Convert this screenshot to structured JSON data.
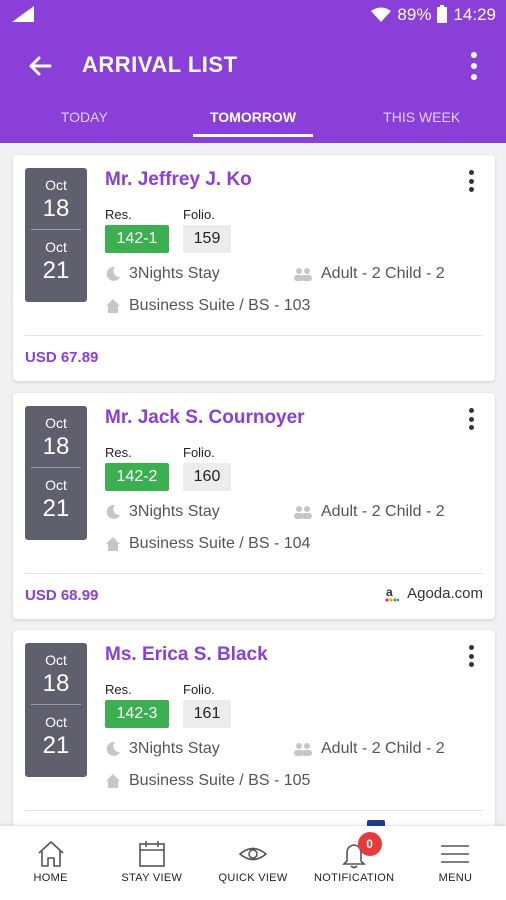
{
  "status_bar": {
    "battery": "89%",
    "time": "14:29"
  },
  "header": {
    "title": "ARRIVAL LIST"
  },
  "tabs": [
    {
      "label": "TODAY",
      "active": false
    },
    {
      "label": "TOMORROW",
      "active": true
    },
    {
      "label": "THIS WEEK",
      "active": false
    }
  ],
  "labels": {
    "res": "Res.",
    "folio": "Folio."
  },
  "reservations": [
    {
      "checkin_month": "Oct",
      "checkin_day": "18",
      "checkout_month": "Oct",
      "checkout_day": "21",
      "guest": "Mr. Jeffrey J. Ko",
      "res_no": "142-1",
      "folio_no": "159",
      "stay": "3Nights Stay",
      "occupancy": "Adult - 2 Child - 2",
      "room": "Business Suite / BS - 103",
      "price": "USD 67.89",
      "source": ""
    },
    {
      "checkin_month": "Oct",
      "checkin_day": "18",
      "checkout_month": "Oct",
      "checkout_day": "21",
      "guest": "Mr. Jack S. Cournoyer",
      "res_no": "142-2",
      "folio_no": "160",
      "stay": "3Nights Stay",
      "occupancy": "Adult - 2 Child - 2",
      "room": "Business Suite / BS - 104",
      "price": "USD 68.99",
      "source": "Agoda.com"
    },
    {
      "checkin_month": "Oct",
      "checkin_day": "18",
      "checkout_month": "Oct",
      "checkout_day": "21",
      "guest": "Ms. Erica S. Black",
      "res_no": "142-3",
      "folio_no": "161",
      "stay": "3Nights Stay",
      "occupancy": "Adult - 2 Child - 2",
      "room": "Business Suite / BS - 105",
      "price": "",
      "source": ""
    }
  ],
  "bottom_nav": [
    {
      "label": "HOME",
      "icon": "home-icon"
    },
    {
      "label": "STAY VIEW",
      "icon": "calendar-icon"
    },
    {
      "label": "QUICK VIEW",
      "icon": "eye-icon"
    },
    {
      "label": "NOTIFICATION",
      "icon": "bell-icon",
      "badge": "0"
    },
    {
      "label": "MENU",
      "icon": "menu-icon"
    }
  ],
  "colors": {
    "primary": "#8a3fd8",
    "res_badge": "#3caf50",
    "date_box": "#5f5f6d",
    "notification_badge": "#e53b3b"
  }
}
